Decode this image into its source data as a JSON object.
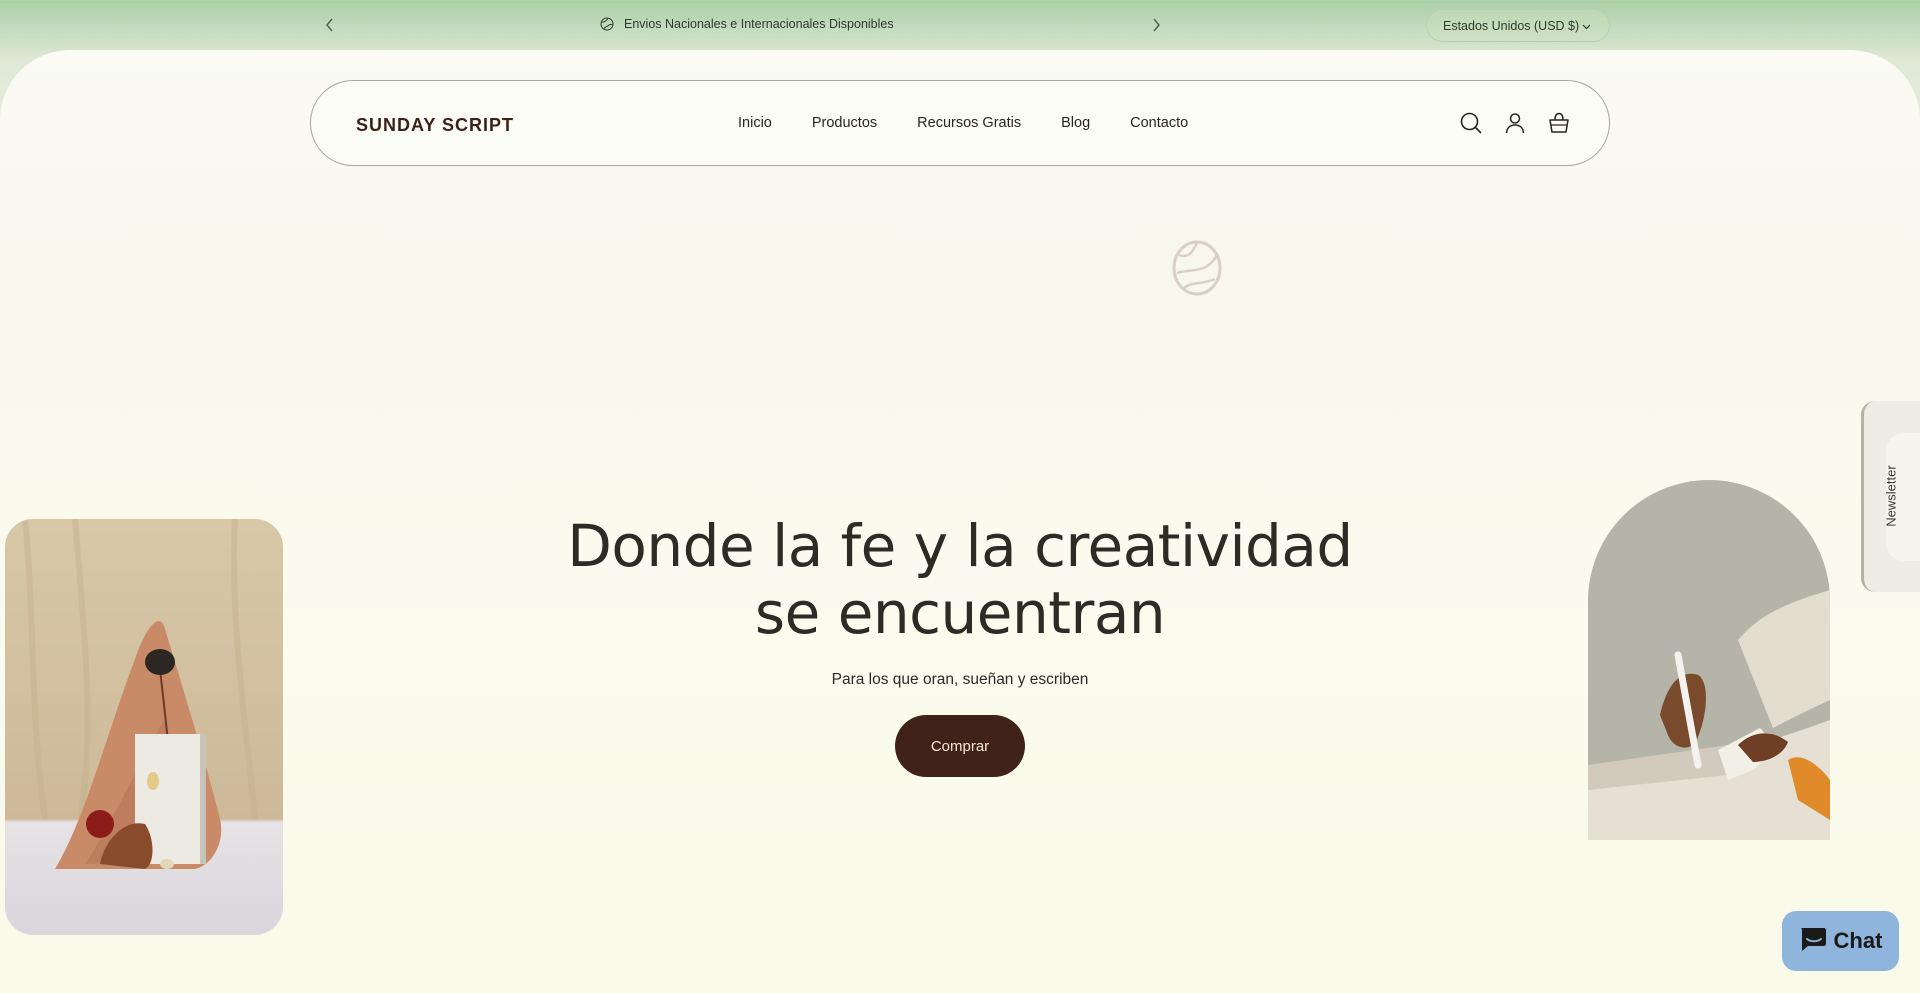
{
  "announcement": {
    "message": "Envios Nacionales e Internacionales Disponibles",
    "prev_icon": "chevron-left-icon",
    "next_icon": "chevron-right-icon"
  },
  "currency": {
    "selected": "Estados Unidos (USD $)"
  },
  "header": {
    "logo": "SUNDAY SCRIPT",
    "nav": [
      "Inicio",
      "Productos",
      "Recursos Gratis",
      "Blog",
      "Contacto"
    ],
    "icons": [
      "search-icon",
      "account-icon",
      "cart-icon"
    ]
  },
  "hero": {
    "title_line1": "Donde la fe y la creatividad",
    "title_line2": "se encuentran",
    "subtitle": "Para los que oran, sueñan y escriben",
    "cta": "Comprar"
  },
  "newsletter": {
    "label": "Newsletter"
  },
  "chat": {
    "label": "Chat"
  },
  "colors": {
    "brand_dark": "#40221a",
    "announce_green": "#a9cfa4",
    "chat_blue": "#8fb5dc"
  }
}
